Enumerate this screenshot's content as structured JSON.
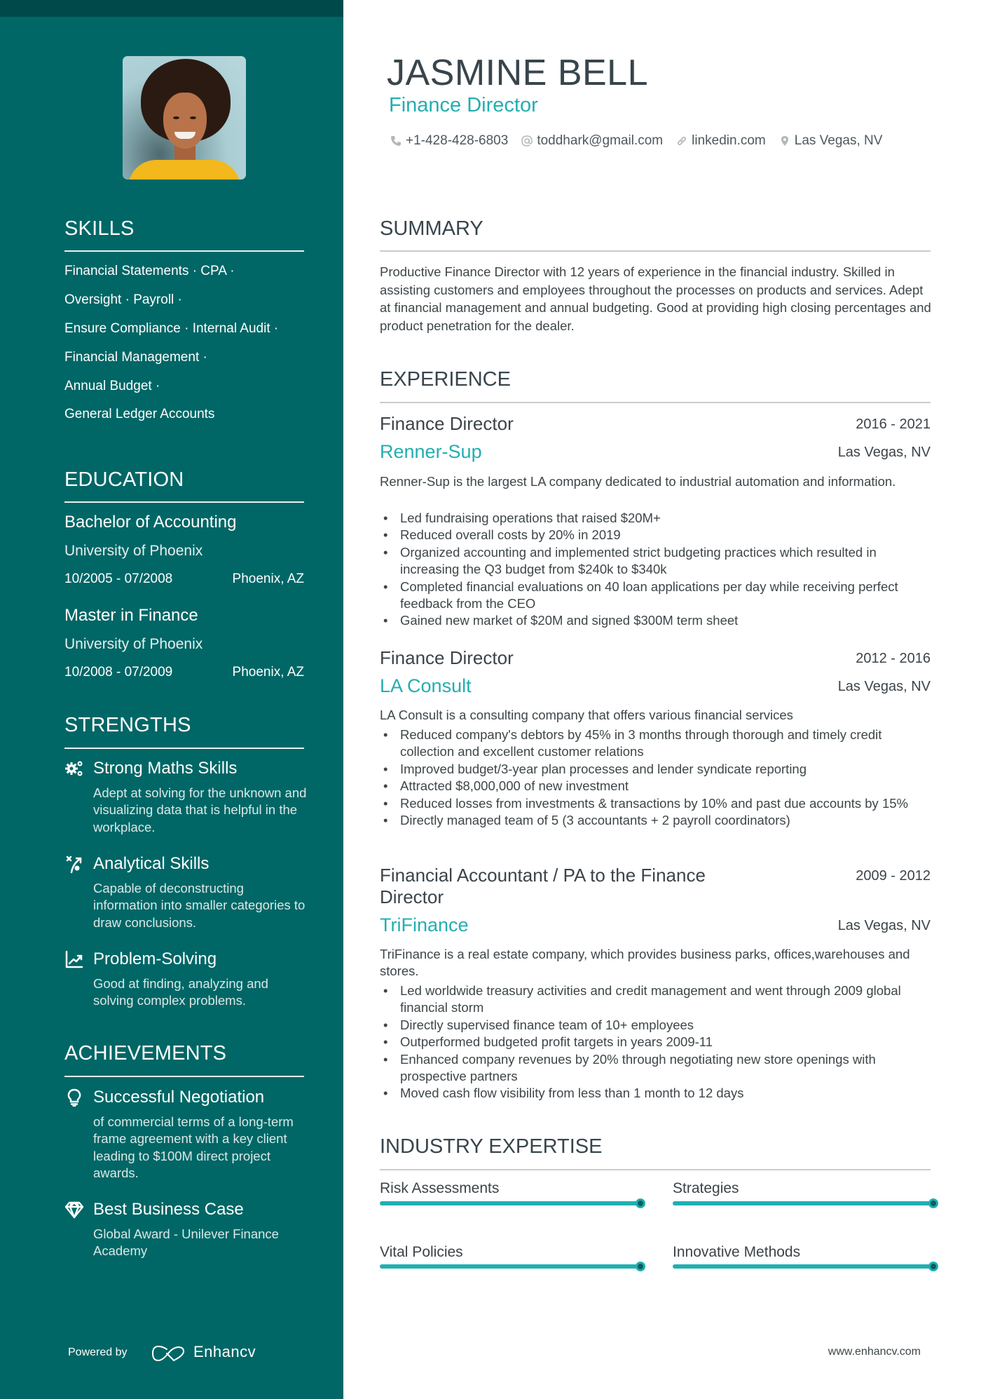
{
  "header": {
    "name": "JASMINE BELL",
    "title": "Finance Director",
    "contacts": [
      {
        "icon": "phone-icon",
        "text": "+1-428-428-6803"
      },
      {
        "icon": "at-icon",
        "text": "toddhark@gmail.com"
      },
      {
        "icon": "link-icon",
        "text": "linkedin.com"
      },
      {
        "icon": "location-pin-icon",
        "text": "Las Vegas, NV"
      }
    ]
  },
  "sidebar": {
    "skills": {
      "heading": "SKILLS",
      "lines": [
        "Financial Statements · CPA ·",
        "Oversight · Payroll ·",
        "Ensure Compliance · Internal Audit ·",
        "Financial Management ·",
        "Annual Budget ·",
        "General Ledger Accounts"
      ]
    },
    "education": {
      "heading": "EDUCATION",
      "items": [
        {
          "degree": "Bachelor of Accounting",
          "school": "University of Phoenix",
          "dates": "10/2005 - 07/2008",
          "location": "Phoenix, AZ"
        },
        {
          "degree": "Master in Finance",
          "school": "University of Phoenix",
          "dates": "10/2008 - 07/2009",
          "location": "Phoenix, AZ"
        }
      ]
    },
    "strengths": {
      "heading": "STRENGTHS",
      "items": [
        {
          "icon": "gears-icon",
          "title": "Strong Maths Skills",
          "desc": "Adept at solving for the unknown and visualizing data that is helpful in the workplace."
        },
        {
          "icon": "strategy-icon",
          "title": "Analytical Skills",
          "desc": "Capable of deconstructing information into smaller categories to draw conclusions."
        },
        {
          "icon": "line-chart-icon",
          "title": "Problem-Solving",
          "desc": "Good at finding, analyzing and solving complex problems."
        }
      ]
    },
    "achievements": {
      "heading": "ACHIEVEMENTS",
      "items": [
        {
          "icon": "lightbulb-icon",
          "title": "Successful Negotiation",
          "desc": "of commercial terms of a long-term frame agreement with a key client leading to $100M direct project awards."
        },
        {
          "icon": "diamond-icon",
          "title": "Best Business Case",
          "desc": "Global Award - Unilever Finance Academy"
        }
      ]
    },
    "footer": {
      "powered_by": "Powered by",
      "brand": "Enhancv"
    }
  },
  "main": {
    "summary": {
      "heading": "SUMMARY",
      "text": "Productive Finance Director with 12 years of experience in the financial industry. Skilled in assisting customers and employees throughout the processes on products and services. Adept at financial management and annual budgeting. Good at providing high closing percentages and product penetration for the dealer."
    },
    "experience": {
      "heading": "EXPERIENCE",
      "jobs": [
        {
          "role": "Finance Director",
          "dates": "2016 - 2021",
          "company": "Renner-Sup",
          "location": "Las Vegas, NV",
          "description": "Renner-Sup is the largest LA company dedicated to industrial automation and information.",
          "bullets": [
            "Led fundraising operations that raised $20M+",
            "Reduced overall costs by 20% in 2019",
            "Organized accounting and implemented strict budgeting practices which resulted in increasing the Q3 budget from $240k to $340k",
            "Completed financial evaluations on 40 loan applications per day while receiving perfect feedback from the CEO",
            "Gained new market of $20M and signed $300M term sheet"
          ]
        },
        {
          "role": "Finance Director",
          "dates": "2012 - 2016",
          "company": "LA Consult",
          "location": "Las Vegas, NV",
          "description": "LA Consult is a consulting company that offers various financial services",
          "bullets": [
            "Reduced company's debtors by 45% in 3 months through thorough and timely credit collection and excellent customer relations",
            "Improved budget/3-year plan processes and lender syndicate reporting",
            "Attracted $8,000,000 of new investment",
            "Reduced losses from investments & transactions by 10% and past due accounts by 15%",
            "Directly managed team of 5 (3 accountants + 2 payroll coordinators)"
          ]
        },
        {
          "role": "Financial Accountant / PA to the Finance Director",
          "dates": "2009 - 2012",
          "company": "TriFinance",
          "location": "Las Vegas, NV",
          "description": "TriFinance is a real estate company, which provides business parks, offices,warehouses and stores.",
          "bullets": [
            "Led worldwide treasury activities and credit management and went through 2009 global financial storm",
            "Directly supervised finance team of 10+ employees",
            "Outperformed budgeted profit targets in years 2009-11",
            "Enhanced company revenues by 20% through negotiating new store openings with prospective partners",
            "Moved cash flow visibility from less than 1 month to 12 days"
          ]
        }
      ]
    },
    "expertise": {
      "heading": "INDUSTRY EXPERTISE",
      "items": [
        {
          "label": "Risk Assessments",
          "level": 1.0
        },
        {
          "label": "Strategies",
          "level": 1.0
        },
        {
          "label": "Vital Policies",
          "level": 1.0
        },
        {
          "label": "Innovative Methods",
          "level": 1.0
        }
      ]
    },
    "footer": {
      "website": "www.enhancv.com"
    }
  },
  "colors": {
    "sidebar": "#006766",
    "sidebar_top": "#00494a",
    "accent": "#1fafb1",
    "knob": "#0b5d5f",
    "heading_text": "#38454c"
  }
}
